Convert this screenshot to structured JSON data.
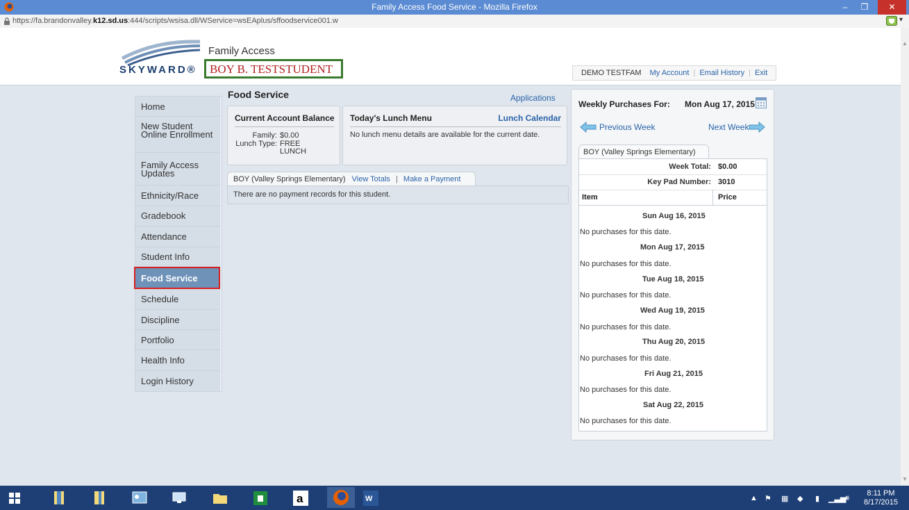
{
  "window": {
    "title": "Family Access Food Service - Mozilla Firefox",
    "min_label": "–",
    "max_label": "❐",
    "close_label": "✕"
  },
  "browser": {
    "url_prefix": "https://fa.brandonvalley.",
    "url_domain": "k12.sd.us",
    "url_rest": ":444/scripts/wsisa.dll/WService=wsEAplus/sffoodservice001.w",
    "ext_dropdown": "▾"
  },
  "header": {
    "logo_text": "SKYWARD®",
    "app_name": "Family Access",
    "student_name": "BOY B. TESTSTUDENT",
    "user": "DEMO TESTFAM",
    "links": {
      "my_account": "My Account",
      "email_history": "Email History",
      "exit": "Exit"
    }
  },
  "sidebar": {
    "items": [
      {
        "label": "Home"
      },
      {
        "label": "New Student Online Enrollment"
      },
      {
        "label": "Family Access Updates"
      },
      {
        "label": "Ethnicity/Race"
      },
      {
        "label": "Gradebook"
      },
      {
        "label": "Attendance"
      },
      {
        "label": "Student Info"
      },
      {
        "label": "Food Service"
      },
      {
        "label": "Schedule"
      },
      {
        "label": "Discipline"
      },
      {
        "label": "Portfolio"
      },
      {
        "label": "Health Info"
      },
      {
        "label": "Login History"
      }
    ],
    "active": "Food Service"
  },
  "main": {
    "title": "Food Service",
    "applications_link": "Applications",
    "balance": {
      "heading": "Current Account Balance",
      "family_key": "Family:",
      "family_val": "$0.00",
      "lunch_type_key": "Lunch Type:",
      "lunch_type_val_1": "FREE",
      "lunch_type_val_2": "LUNCH"
    },
    "lunch": {
      "heading": "Today's Lunch Menu",
      "calendar_link": "Lunch Calendar",
      "message": "No lunch menu details are available for the current date."
    },
    "payments": {
      "tab_student": "BOY (Valley Springs Elementary)",
      "view_totals": "View Totals",
      "pipe": "|",
      "make_payment": "Make a Payment",
      "message": "There are no payment records for this student."
    }
  },
  "weekly": {
    "label": "Weekly Purchases For:",
    "date": "Mon Aug 17, 2015",
    "prev": "Previous Week",
    "next": "Next Week",
    "tab": "BOY (Valley Springs Elementary)",
    "week_total_label": "Week Total:",
    "week_total": "$0.00",
    "keypad_label": "Key Pad Number:",
    "keypad": "3010",
    "col_item": "Item",
    "col_price": "Price",
    "days": [
      {
        "date": "Sun Aug 16, 2015",
        "note": "No purchases for this date."
      },
      {
        "date": "Mon Aug 17, 2015",
        "note": "No purchases for this date."
      },
      {
        "date": "Tue Aug 18, 2015",
        "note": "No purchases for this date."
      },
      {
        "date": "Wed Aug 19, 2015",
        "note": "No purchases for this date."
      },
      {
        "date": "Thu Aug 20, 2015",
        "note": "No purchases for this date."
      },
      {
        "date": "Fri Aug 21, 2015",
        "note": "No purchases for this date."
      },
      {
        "date": "Sat Aug 22, 2015",
        "note": "No purchases for this date."
      }
    ]
  },
  "taskbar": {
    "time": "8:11 PM",
    "date": "8/17/2015",
    "tray_up": "▲"
  }
}
